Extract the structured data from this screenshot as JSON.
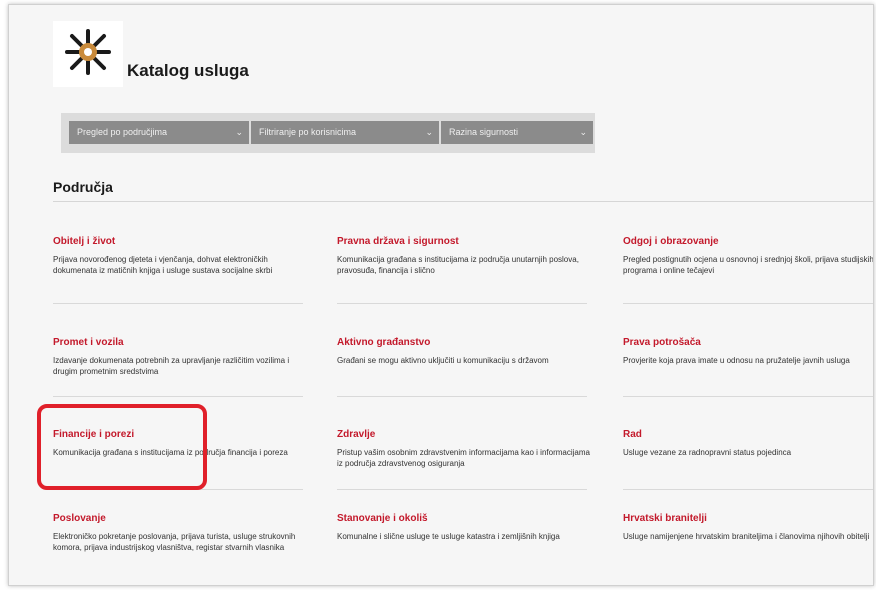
{
  "header": {
    "title": "Katalog usluga"
  },
  "filters": [
    {
      "label": "Pregled po područjima"
    },
    {
      "label": "Filtriranje po korisnicima"
    },
    {
      "label": "Razina sigurnosti"
    }
  ],
  "section": {
    "heading": "Područja"
  },
  "categories": [
    {
      "title": "Obitelj i život",
      "description": "Prijava novorođenog djeteta i vjenčanja, dohvat elektroničkih dokumenata iz matičnih knjiga i usluge sustava socijalne skrbi"
    },
    {
      "title": "Pravna država i sigurnost",
      "description": "Komunikacija građana s institucijama iz područja unutarnjih poslova, pravosuđa, financija i slično"
    },
    {
      "title": "Odgoj i obrazovanje",
      "description": "Pregled postignutih ocjena u osnovnoj i srednjoj školi, prijava studijskih programa i online tečajevi"
    },
    {
      "title": "Promet i vozila",
      "description": "Izdavanje dokumenata potrebnih za upravljanje različitim vozilima i drugim prometnim sredstvima"
    },
    {
      "title": "Aktivno građanstvo",
      "description": "Građani se mogu aktivno uključiti u komunikaciju s državom"
    },
    {
      "title": "Prava potrošača",
      "description": "Provjerite koja prava imate u odnosu na pružatelje javnih usluga"
    },
    {
      "title": "Financije i porezi",
      "description": "Komunikacija građana s institucijama iz područja financija i poreza"
    },
    {
      "title": "Zdravlje",
      "description": "Pristup vašim osobnim zdravstvenim informacijama kao i informacijama iz područja zdravstvenog osiguranja"
    },
    {
      "title": "Rad",
      "description": "Usluge vezane za radnopravni status pojedinca"
    },
    {
      "title": "Poslovanje",
      "description": "Elektroničko pokretanje poslovanja, prijava turista, usluge strukovnih komora, prijava industrijskog vlasništva, registar stvarnih vlasnika"
    },
    {
      "title": "Stanovanje i okoliš",
      "description": "Komunalne i slične usluge te usluge katastra i zemljišnih knjiga"
    },
    {
      "title": "Hrvatski branitelji",
      "description": "Usluge namijenjene hrvatskim braniteljima i članovima njihovih obitelji"
    }
  ],
  "colors": {
    "accent": "#c3192b",
    "highlight": "#e0202a",
    "filter_bar": "#8b8b8b"
  },
  "icons": {
    "logo": "gov-logo-icon",
    "filter_chevron": "chevron-down-icon"
  }
}
